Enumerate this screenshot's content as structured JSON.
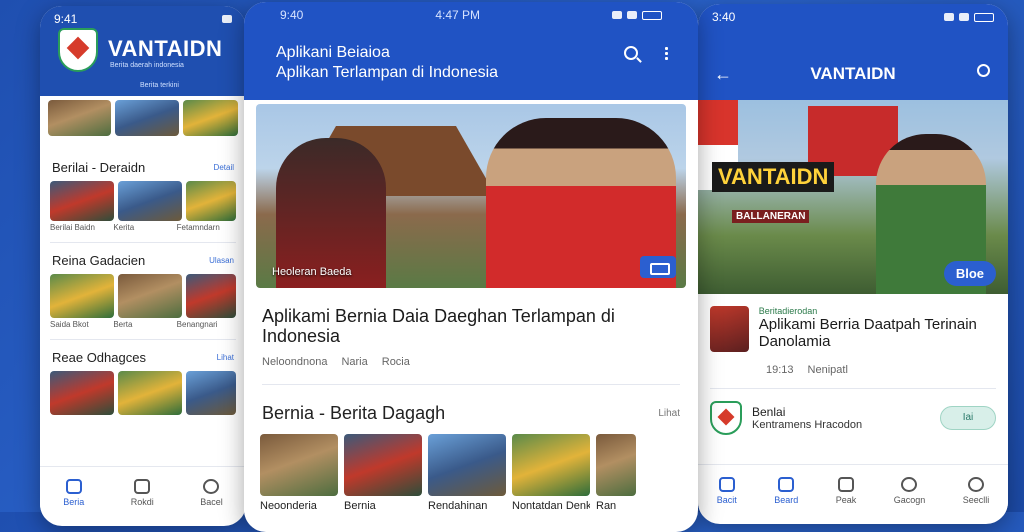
{
  "left": {
    "status_time": "9:41",
    "brand": "VANTAIDN",
    "subtitle": "Berita daerah indonesia",
    "subtitle2": "Berita terkini",
    "section1": {
      "title": "Berilai - Deraidn",
      "more": "Detail"
    },
    "section1_caps": [
      "Berilai Baidn",
      "Kerita",
      "Fetamndarn"
    ],
    "section2": {
      "title": "Reina Gadacien",
      "more": "Ulasan"
    },
    "section2_caps": [
      "Saida Bkot",
      "Berta",
      "Benangnari"
    ],
    "section3": {
      "title": "Reae Odhagces",
      "more": "Lihat"
    },
    "tabs": [
      "Beria",
      "Rokdi",
      "Bacel"
    ]
  },
  "mid": {
    "status_left": "9:40",
    "status_mid": "4:47 PM",
    "title1": "Aplikani Beiaioa",
    "title2": "Aplikan Terlampan di Indonesia",
    "hero_caption": "Heoleran Baeda",
    "headline": "Aplikami Bernia Daia Daeghan Terlampan di Indonesia",
    "meta": [
      "Neloondnona",
      "Naria",
      "Rocia"
    ],
    "section": {
      "title": "Bernia - Berita Dagagh",
      "more": "Lihat"
    },
    "captions": [
      "Neoonderia",
      "Bernia",
      "Rendahinan",
      "Nontatdan Denkan",
      "Ran"
    ]
  },
  "right": {
    "status_time": "3:40",
    "title": "VANTAIDN",
    "hero_big": "VANTAIDN",
    "hero_banner": "BALLANERAN",
    "hero_pill": "Bloe",
    "card_tag": "Beritadierodan",
    "card_title": "Aplikami Berria Daatpah Terinain Danolamia",
    "meta": [
      "19:13",
      "Nenipatl"
    ],
    "item_a": "Benlai",
    "item_b": "Kentramens Hracodon",
    "item_btn": "Iai",
    "tabs": [
      "Bacit",
      "Beard",
      "Peak",
      "Gacogn",
      "Seeclli"
    ]
  }
}
